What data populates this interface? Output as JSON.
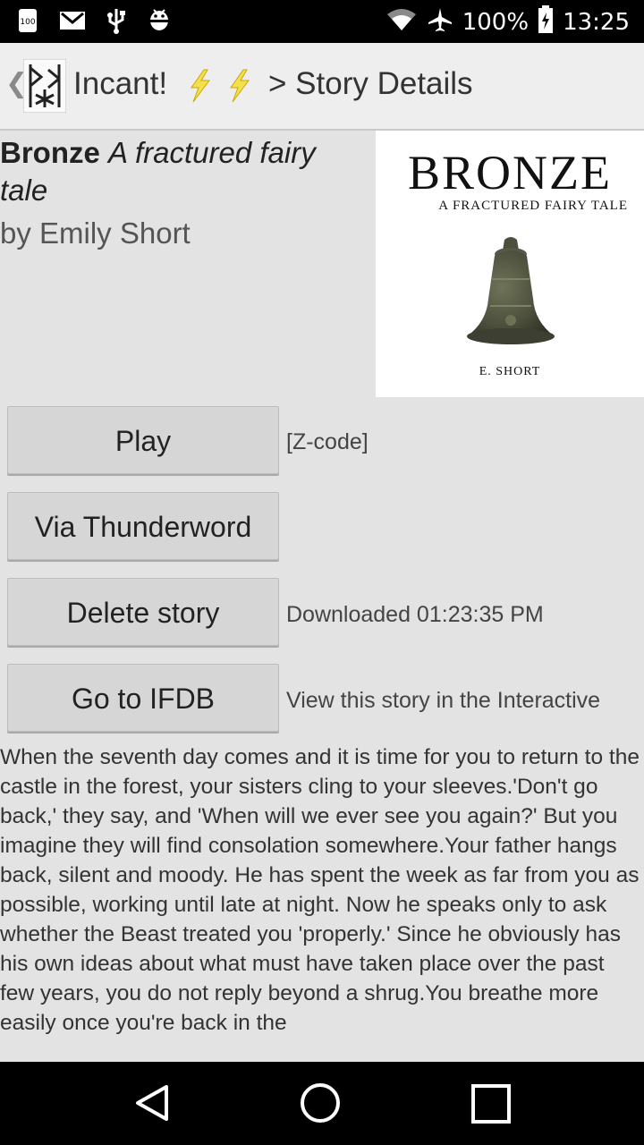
{
  "status_bar": {
    "battery_text": "100%",
    "time": "13:25",
    "left_icons": [
      "notification-100-icon",
      "gmail-icon",
      "usb-icon",
      "android-debug-icon"
    ],
    "right_icons": [
      "wifi-icon",
      "airplane-icon",
      "battery-icon"
    ]
  },
  "action_bar": {
    "app_title": "Incant!",
    "breadcrumb": "> Story Details"
  },
  "story": {
    "title": "Bronze",
    "subtitle": "A fractured fairy tale",
    "author": "by Emily Short",
    "cover": {
      "title": "BRONZE",
      "subtitle": "A FRACTURED FAIRY TALE",
      "author": "E. SHORT"
    }
  },
  "actions": {
    "play_label": "Play",
    "format": "[Z-code]",
    "thunderword_label": "Via Thunderword",
    "delete_label": "Delete story",
    "downloaded_text": "Downloaded 01:23:35 PM",
    "ifdb_label": "Go to IFDB",
    "ifdb_text": "View this story in the Interactive"
  },
  "description": "When the seventh day comes and it is time for you to return to the castle in the forest, your sisters cling to your sleeves.'Don't go back,' they say, and 'When will we ever see you again?' But you imagine they will find consolation somewhere.Your father hangs back, silent and moody. He has spent the week as far from you as possible, working until late at night. Now he speaks only to ask whether the Beast treated you 'properly.' Since he obviously has his own ideas about what must have taken place over the past few years, you do not reply beyond a shrug.You breathe more easily once you're back in the"
}
